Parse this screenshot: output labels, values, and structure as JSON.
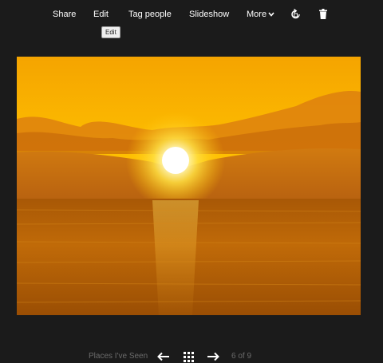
{
  "toolbar": {
    "share_label": "Share",
    "edit_label": "Edit",
    "tag_people_label": "Tag people",
    "slideshow_label": "Slideshow",
    "more_label": "More",
    "rotate_icon": "rotate-icon",
    "delete_icon": "trash-icon"
  },
  "tooltip": {
    "text": "Edit"
  },
  "photo": {
    "description_icon": "sunset-photo"
  },
  "footer": {
    "album_name": "Places I've Seen",
    "counter": "6 of 9",
    "prev_icon": "arrow-left-icon",
    "grid_icon": "grid-icon",
    "next_icon": "arrow-right-icon"
  },
  "colors": {
    "background": "#1b1b1b",
    "toolbar_text": "#ffffff",
    "footer_text": "#6b6b6b"
  }
}
